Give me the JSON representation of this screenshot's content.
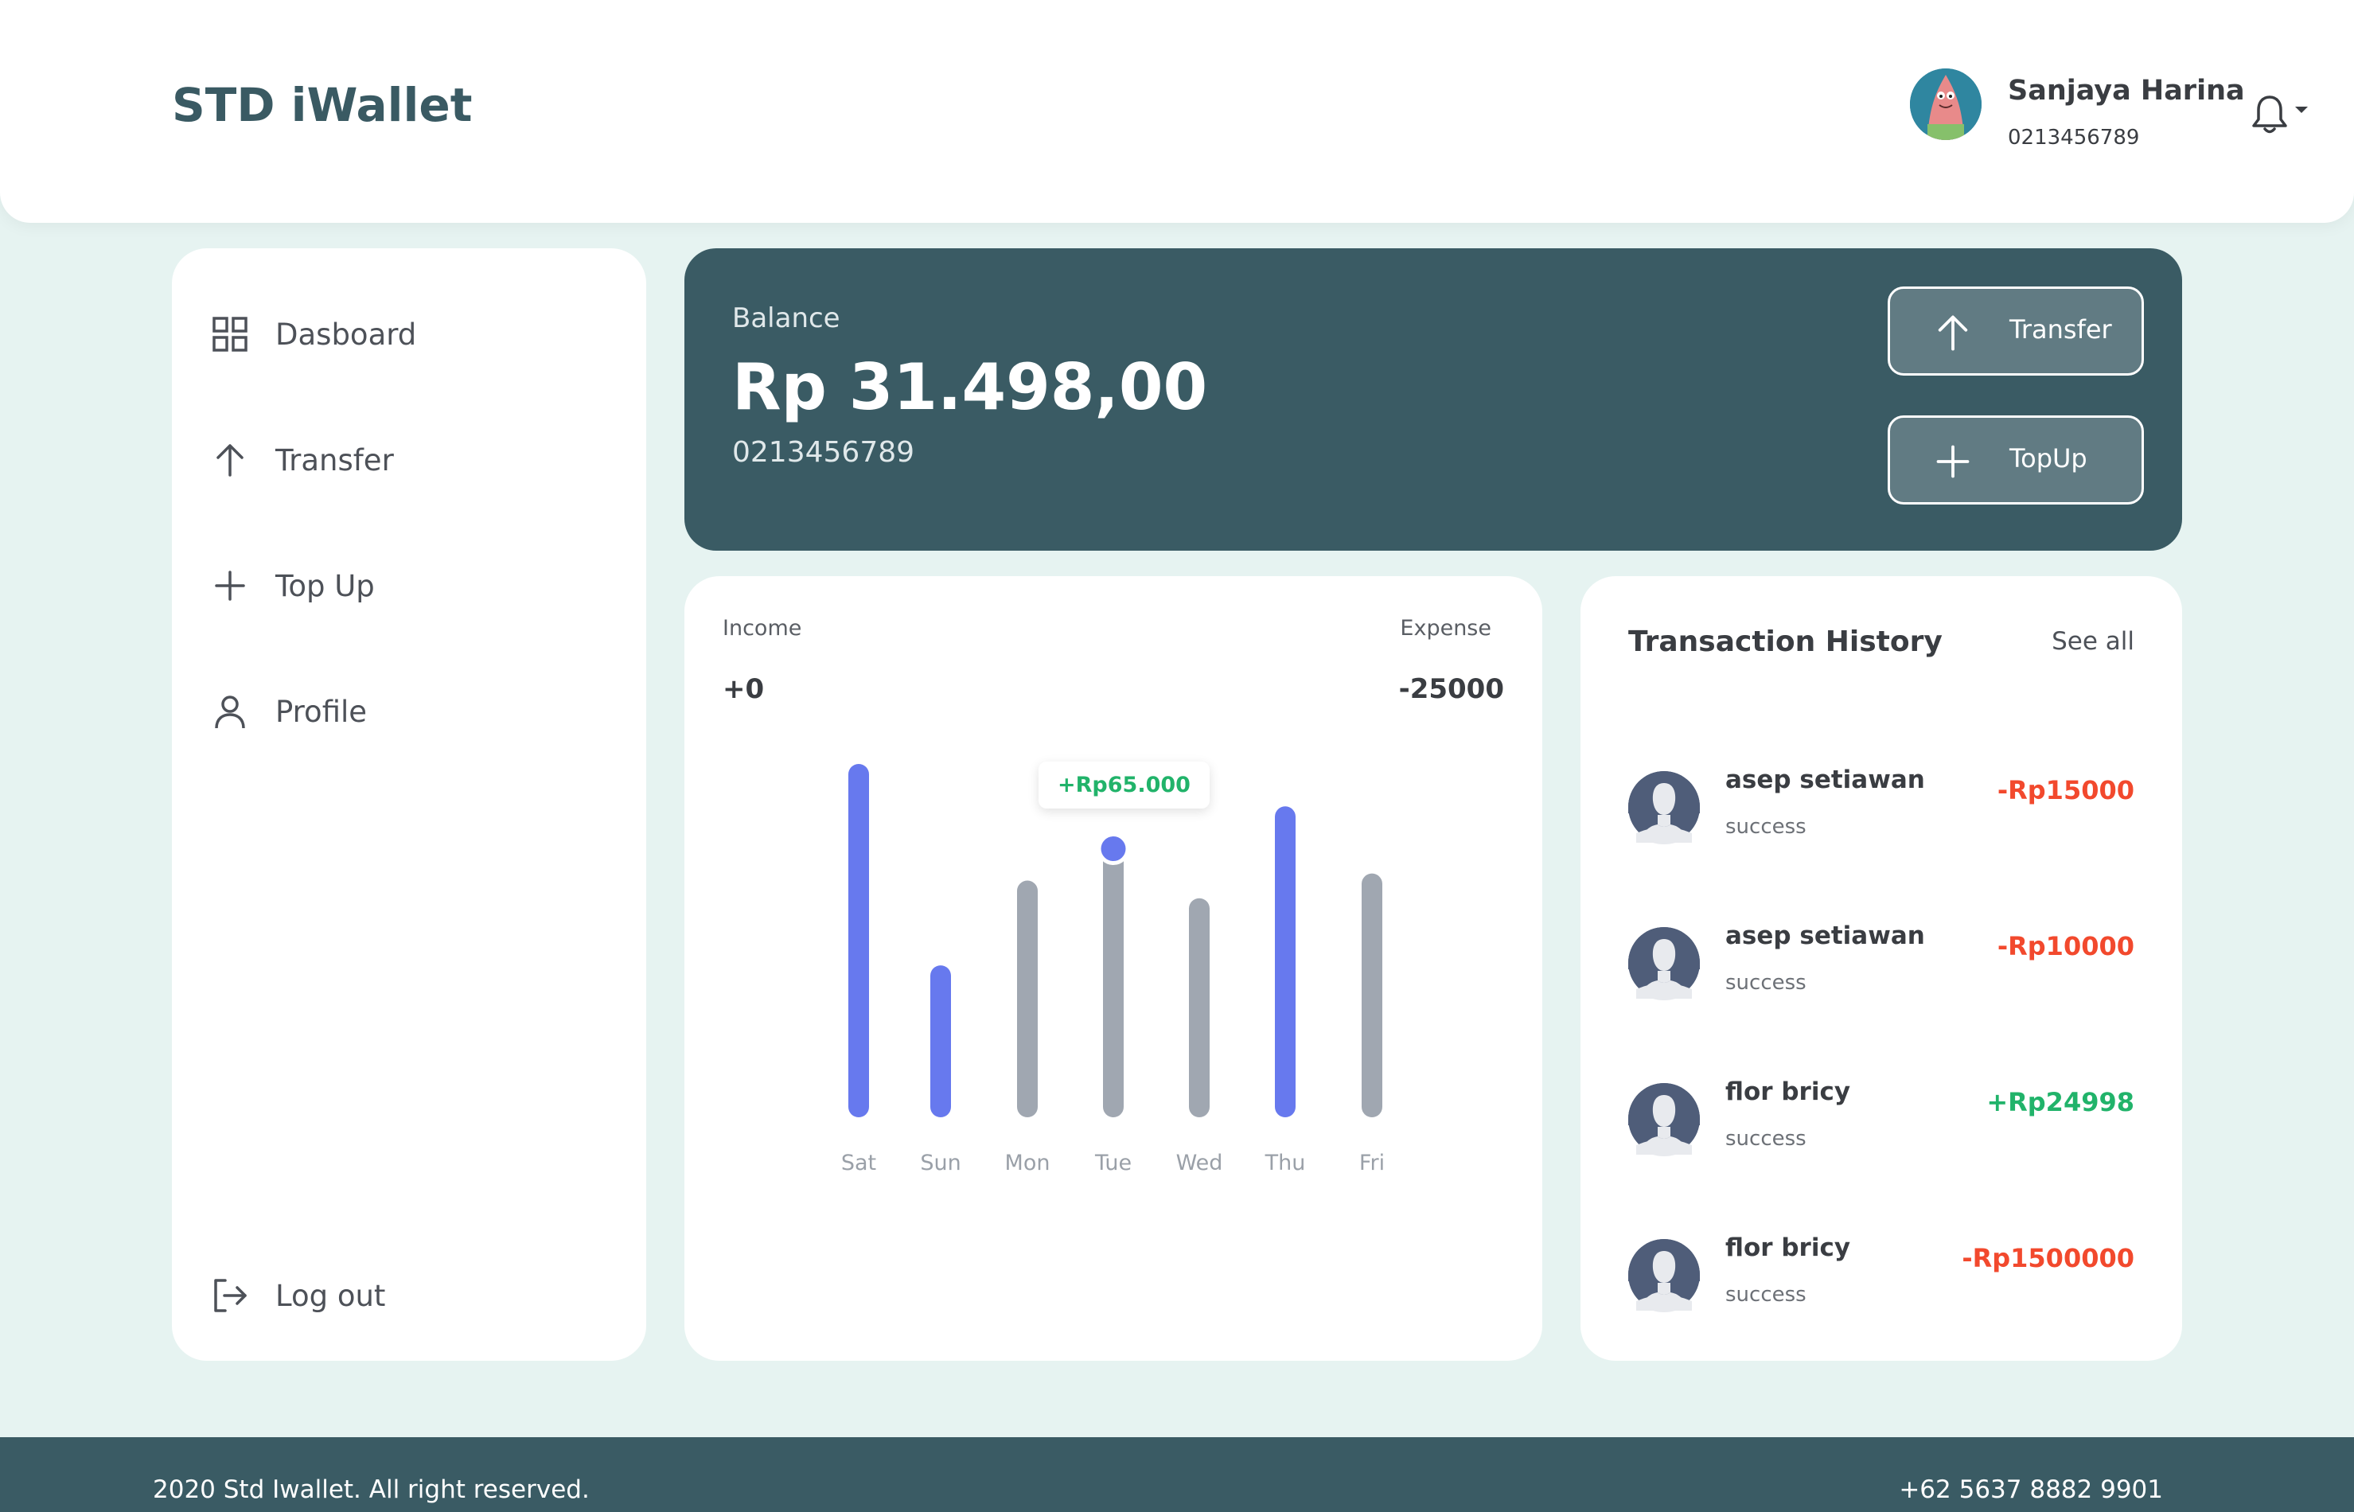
{
  "app": {
    "brand": "STD iWallet"
  },
  "user": {
    "name": "Sanjaya Harina",
    "phone": "0213456789"
  },
  "sidebar": {
    "items": [
      {
        "label": "Dasboard",
        "icon": "grid-icon"
      },
      {
        "label": "Transfer",
        "icon": "arrow-up-icon"
      },
      {
        "label": "Top Up",
        "icon": "plus-icon"
      },
      {
        "label": "Profile",
        "icon": "user-icon"
      }
    ],
    "logout": {
      "label": "Log out",
      "icon": "logout-icon"
    }
  },
  "balance": {
    "label": "Balance",
    "amount": "Rp 31.498,00",
    "phone": "0213456789",
    "transfer_label": "Transfer",
    "topup_label": "TopUp"
  },
  "summary": {
    "income_label": "Income",
    "income_value": "+0",
    "expense_label": "Expense",
    "expense_value": "-25000"
  },
  "chart_data": {
    "type": "bar",
    "categories": [
      "Sat",
      "Sun",
      "Mon",
      "Tue",
      "Wed",
      "Thu",
      "Fri"
    ],
    "values": [
      100,
      43,
      67,
      76,
      62,
      88,
      69
    ],
    "bar_kind": [
      "income",
      "income",
      "expense",
      "expense",
      "expense",
      "income",
      "expense"
    ],
    "highlight": {
      "index": 3,
      "label": "+Rp65.000"
    },
    "colors": {
      "income": "#6779ee",
      "expense": "#a0a7b1",
      "tooltip_text": "#21b36a"
    }
  },
  "transactions": {
    "title": "Transaction History",
    "see_all": "See all",
    "items": [
      {
        "name": "asep setiawan",
        "status": "success",
        "amount": "-Rp15000",
        "type": "debit"
      },
      {
        "name": "asep setiawan",
        "status": "success",
        "amount": "-Rp10000",
        "type": "debit"
      },
      {
        "name": "flor bricy",
        "status": "success",
        "amount": "+Rp24998",
        "type": "credit"
      },
      {
        "name": "flor bricy",
        "status": "success",
        "amount": "-Rp1500000",
        "type": "debit"
      }
    ],
    "colors": {
      "debit": "#f2492d",
      "credit": "#21b36a"
    }
  },
  "footer": {
    "copyright": "2020 Std Iwallet. All right reserved.",
    "phone": "+62 5637 8882 9901"
  }
}
